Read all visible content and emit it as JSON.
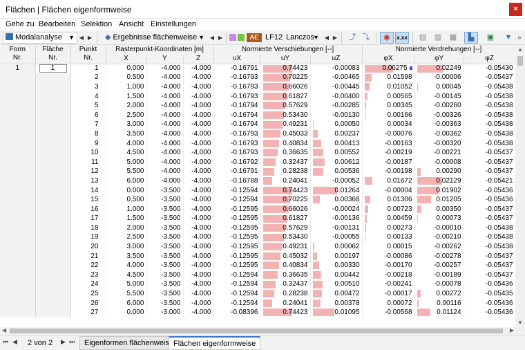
{
  "window": {
    "title": "Flächen | Flächen eigenformweise",
    "close": "×"
  },
  "menu": [
    "Gehe zu",
    "Bearbeiten",
    "Selektion",
    "Ansicht",
    "Einstellungen"
  ],
  "toolbar": {
    "analysis": "Modalanalyse",
    "results": "Ergebnisse flächenweise",
    "ae": "AE",
    "lf": "LF12",
    "method": "Lanczos",
    "accent": "#d8b4f2"
  },
  "headers": {
    "form": "Form\nNr.",
    "flaeche": "Fläche\nNr.",
    "punkt": "Punkt\nNr.",
    "coords_group": "Rasterpunkt-Koordinaten [m]",
    "x": "X",
    "y": "Y",
    "z": "Z",
    "verschiebung_group": "Normierte Verschiebungen [--]",
    "ux": "uX",
    "uy": "uY",
    "uz": "uZ",
    "verdrehung_group": "Normierte Verdrehungen [--]",
    "phix": "φX",
    "phiy": "φY",
    "phiz": "φZ"
  },
  "form_nr": "1",
  "flaeche_nr": "1",
  "rows": [
    [
      "1",
      "0.000",
      "-4.000",
      "-4.000",
      "-0.16791",
      "0.74423",
      "-0.00083",
      "0.06275",
      "0.02249",
      "-0.05430"
    ],
    [
      "2",
      "0.500",
      "-4.000",
      "-4.000",
      "-0.16793",
      "0.70225",
      "-0.00465",
      "0.01598",
      "-0.00006",
      "-0.05437"
    ],
    [
      "3",
      "1.000",
      "-4.000",
      "-4.000",
      "-0.16793",
      "0.66026",
      "-0.00445",
      "0.01052",
      "0.00045",
      "-0.05438"
    ],
    [
      "4",
      "1.500",
      "-4.000",
      "-4.000",
      "-0.16793",
      "0.61827",
      "-0.00400",
      "0.00565",
      "-0.00145",
      "-0.05438"
    ],
    [
      "5",
      "2.000",
      "-4.000",
      "-4.000",
      "-0.16794",
      "0.57629",
      "-0.00285",
      "0.00345",
      "-0.00260",
      "-0.05438"
    ],
    [
      "6",
      "2.500",
      "-4.000",
      "-4.000",
      "-0.16794",
      "0.53430",
      "-0.00130",
      "0.00166",
      "-0.00326",
      "-0.05438"
    ],
    [
      "7",
      "3.000",
      "-4.000",
      "-4.000",
      "-0.16794",
      "0.49231",
      "0.00050",
      "0.00034",
      "-0.00363",
      "-0.05438"
    ],
    [
      "8",
      "3.500",
      "-4.000",
      "-4.000",
      "-0.16793",
      "0.45033",
      "0.00237",
      "-0.00076",
      "-0.00362",
      "-0.05438"
    ],
    [
      "9",
      "4.000",
      "-4.000",
      "-4.000",
      "-0.16793",
      "0.40834",
      "0.00413",
      "-0.00163",
      "-0.00320",
      "-0.05438"
    ],
    [
      "10",
      "4.500",
      "-4.000",
      "-4.000",
      "-0.16793",
      "0.36635",
      "0.00552",
      "-0.00219",
      "-0.00221",
      "-0.05437"
    ],
    [
      "11",
      "5.000",
      "-4.000",
      "-4.000",
      "-0.16792",
      "0.32437",
      "0.00612",
      "-0.00187",
      "-0.00008",
      "-0.05437"
    ],
    [
      "12",
      "5.500",
      "-4.000",
      "-4.000",
      "-0.16791",
      "0.28238",
      "0.00536",
      "-0.00198",
      "0.00290",
      "-0.05437"
    ],
    [
      "13",
      "6.000",
      "-4.000",
      "-4.000",
      "-0.16788",
      "0.24041",
      "-0.00052",
      "0.01672",
      "0.02129",
      "-0.05421"
    ],
    [
      "14",
      "0.000",
      "-3.500",
      "-4.000",
      "-0.12594",
      "0.74423",
      "0.01264",
      "-0.00004",
      "0.01902",
      "-0.05436"
    ],
    [
      "15",
      "0.500",
      "-3.500",
      "-4.000",
      "-0.12594",
      "0.70225",
      "0.00368",
      "0.01306",
      "0.01205",
      "-0.05436"
    ],
    [
      "16",
      "1.000",
      "-3.500",
      "-4.000",
      "-0.12595",
      "0.66026",
      "-0.00024",
      "0.00723",
      "0.00350",
      "-0.05437"
    ],
    [
      "17",
      "1.500",
      "-3.500",
      "-4.000",
      "-0.12595",
      "0.61827",
      "-0.00136",
      "0.00459",
      "0.00073",
      "-0.05437"
    ],
    [
      "18",
      "2.000",
      "-3.500",
      "-4.000",
      "-0.12595",
      "0.57629",
      "-0.00131",
      "0.00273",
      "-0.00010",
      "-0.05438"
    ],
    [
      "19",
      "2.500",
      "-3.500",
      "-4.000",
      "-0.12595",
      "0.53430",
      "-0.00055",
      "0.00133",
      "-0.00210",
      "-0.05438"
    ],
    [
      "20",
      "3.000",
      "-3.500",
      "-4.000",
      "-0.12595",
      "0.49231",
      "0.00062",
      "0.00015",
      "-0.00262",
      "-0.05438"
    ],
    [
      "21",
      "3.500",
      "-3.500",
      "-4.000",
      "-0.12595",
      "0.45032",
      "0.00197",
      "-0.00086",
      "-0.00278",
      "-0.05437"
    ],
    [
      "22",
      "4.000",
      "-3.500",
      "-4.000",
      "-0.12595",
      "0.40834",
      "0.00330",
      "-0.00170",
      "-0.00257",
      "-0.05437"
    ],
    [
      "23",
      "4.500",
      "-3.500",
      "-4.000",
      "-0.12594",
      "0.36635",
      "0.00442",
      "-0.00218",
      "-0.00189",
      "-0.05437"
    ],
    [
      "24",
      "5.000",
      "-3.500",
      "-4.000",
      "-0.12594",
      "0.32437",
      "0.00510",
      "-0.00241",
      "-0.00078",
      "-0.05436"
    ],
    [
      "25",
      "5.500",
      "-3.500",
      "-4.000",
      "-0.12594",
      "0.28238",
      "0.00472",
      "-0.00017",
      "0.00272",
      "-0.05435"
    ],
    [
      "26",
      "6.000",
      "-3.500",
      "-4.000",
      "-0.12594",
      "0.24041",
      "0.00378",
      "0.00072",
      "0.00116",
      "-0.05436"
    ],
    [
      "27",
      "0.000",
      "-3.000",
      "-4.000",
      "-0.08396",
      "0.74423",
      "0.01095",
      "-0.00568",
      "0.01124",
      "-0.05436"
    ]
  ],
  "pager": {
    "text": "2 von 2"
  },
  "tabs": [
    "Eigenformen flächenweise",
    "Flächen eigenformweise"
  ]
}
